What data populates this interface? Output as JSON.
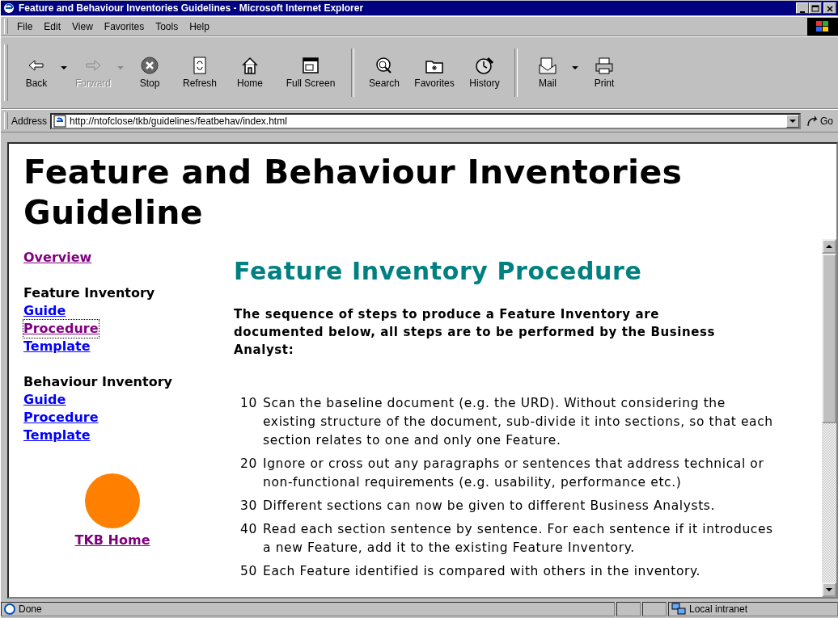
{
  "window": {
    "title": "Feature and Behaviour Inventories Guidelines - Microsoft Internet Explorer"
  },
  "menu": [
    "File",
    "Edit",
    "View",
    "Favorites",
    "Tools",
    "Help"
  ],
  "toolbar": [
    {
      "label": "Back",
      "kind": "back",
      "disabled": false,
      "dropdown": true
    },
    {
      "label": "Forward",
      "kind": "forward",
      "disabled": true,
      "dropdown": true
    },
    {
      "label": "Stop",
      "kind": "stop",
      "disabled": false,
      "dropdown": false
    },
    {
      "label": "Refresh",
      "kind": "refresh",
      "disabled": false,
      "dropdown": false
    },
    {
      "label": "Home",
      "kind": "home",
      "disabled": false,
      "dropdown": false
    },
    {
      "label": "Full Screen",
      "kind": "fullscreen",
      "disabled": false,
      "dropdown": false
    },
    {
      "label": "Search",
      "kind": "search",
      "disabled": false,
      "dropdown": false
    },
    {
      "label": "Favorites",
      "kind": "favorites",
      "disabled": false,
      "dropdown": false
    },
    {
      "label": "History",
      "kind": "history",
      "disabled": false,
      "dropdown": false
    },
    {
      "label": "Mail",
      "kind": "mail",
      "disabled": false,
      "dropdown": true
    },
    {
      "label": "Print",
      "kind": "print",
      "disabled": false,
      "dropdown": false
    }
  ],
  "address": {
    "label": "Address",
    "value": "http://ntofclose/tkb/guidelines/featbehav/index.html",
    "go": "Go"
  },
  "page": {
    "title": "Feature and Behaviour Inventories Guideline",
    "nav": [
      {
        "kind": "link",
        "label": "Overview",
        "visited": true,
        "focused": false
      },
      {
        "kind": "heading",
        "label": "Feature Inventory"
      },
      {
        "kind": "link",
        "label": "Guide",
        "visited": false,
        "focused": false
      },
      {
        "kind": "link",
        "label": "Procedure",
        "visited": true,
        "focused": true
      },
      {
        "kind": "link",
        "label": "Template",
        "visited": false,
        "focused": false
      },
      {
        "kind": "heading",
        "label": "Behaviour Inventory"
      },
      {
        "kind": "link",
        "label": "Guide",
        "visited": false,
        "focused": false
      },
      {
        "kind": "link",
        "label": "Procedure",
        "visited": false,
        "focused": false
      },
      {
        "kind": "link",
        "label": "Template",
        "visited": false,
        "focused": false
      }
    ],
    "home_link": {
      "label": "TKB Home",
      "visited": true
    },
    "heading": "Feature Inventory Procedure",
    "intro": "The sequence of steps to produce a Feature Inventory are documented below, all steps are to be performed by the Business Analyst:",
    "steps": [
      {
        "number": "10",
        "text": "Scan the baseline document (e.g. the URD). Without considering the existing structure of the document, sub-divide it into sections, so that each section relates to one and only one Feature."
      },
      {
        "number": "20",
        "text": "Ignore or cross out any paragraphs or sentences that address technical or non-functional requirements (e.g. usability, performance etc.)"
      },
      {
        "number": "30",
        "text": "Different sections can now be given to different Business Analysts."
      },
      {
        "number": "40",
        "text": "Read each section sentence by sentence. For each sentence if it introduces a new Feature, add it to the existing Feature Inventory."
      },
      {
        "number": "50",
        "text": "Each Feature identified is compared with others in the inventory."
      }
    ]
  },
  "status_bar": {
    "text": "Done",
    "zone": "Local intranet"
  }
}
